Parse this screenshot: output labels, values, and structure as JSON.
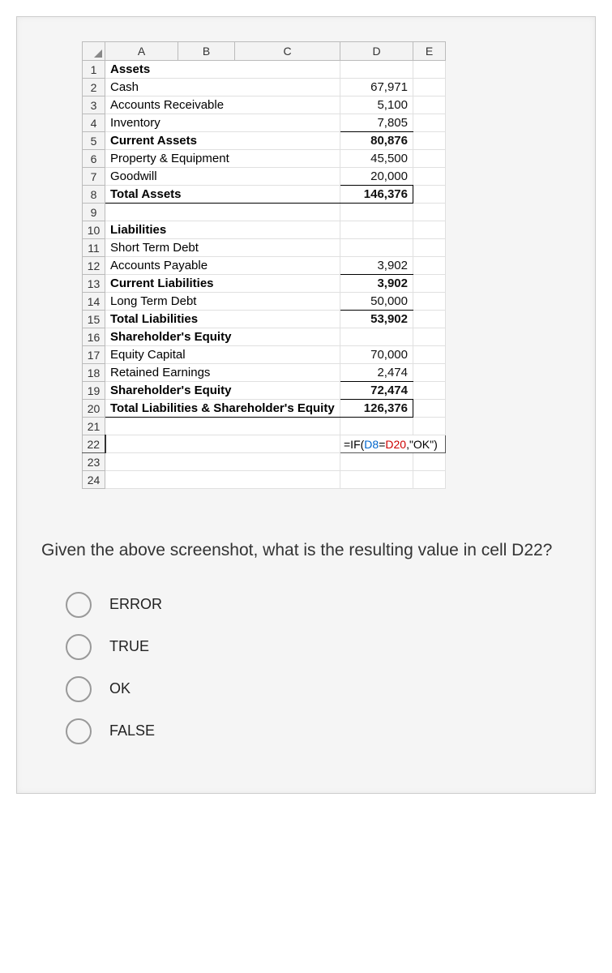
{
  "cols": {
    "corner": "",
    "A": "A",
    "B": "B",
    "C": "C",
    "D": "D",
    "E": "E"
  },
  "rows": {
    "1": {
      "n": "1",
      "a": "Assets",
      "d": "",
      "bold": true
    },
    "2": {
      "n": "2",
      "a": "Cash",
      "d": "67,971",
      "bold": false
    },
    "3": {
      "n": "3",
      "a": "Accounts Receivable",
      "d": "5,100",
      "bold": false
    },
    "4": {
      "n": "4",
      "a": "Inventory",
      "d": "7,805",
      "bold": false,
      "underline": true
    },
    "5": {
      "n": "5",
      "a": "Current Assets",
      "d": "80,876",
      "bold": true
    },
    "6": {
      "n": "6",
      "a": "Property & Equipment",
      "d": "45,500",
      "bold": false
    },
    "7": {
      "n": "7",
      "a": "Goodwill",
      "d": "20,000",
      "bold": false,
      "underline": true
    },
    "8": {
      "n": "8",
      "a": "Total Assets",
      "d": "146,376",
      "bold": true,
      "box": true
    },
    "9": {
      "n": "9",
      "a": "",
      "d": "",
      "bold": false
    },
    "10": {
      "n": "10",
      "a": "Liabilities",
      "d": "",
      "bold": true
    },
    "11": {
      "n": "11",
      "a": "Short Term Debt",
      "d": "",
      "bold": false
    },
    "12": {
      "n": "12",
      "a": "Accounts Payable",
      "d": "3,902",
      "bold": false,
      "underline": true
    },
    "13": {
      "n": "13",
      "a": "Current Liabilities",
      "d": "3,902",
      "bold": true
    },
    "14": {
      "n": "14",
      "a": "Long Term Debt",
      "d": "50,000",
      "bold": false,
      "underline": true
    },
    "15": {
      "n": "15",
      "a": "Total Liabilities",
      "d": "53,902",
      "bold": true
    },
    "16": {
      "n": "16",
      "a": "Shareholder's Equity",
      "d": "",
      "bold": true
    },
    "17": {
      "n": "17",
      "a": "Equity Capital",
      "d": "70,000",
      "bold": false
    },
    "18": {
      "n": "18",
      "a": "Retained Earnings",
      "d": "2,474",
      "bold": false,
      "underline": true
    },
    "19": {
      "n": "19",
      "a": "Shareholder's Equity",
      "d": "72,474",
      "bold": true,
      "underline": true
    },
    "20": {
      "n": "20",
      "a": "Total Liabilities & Shareholder's Equity",
      "d": "126,376",
      "bold": true,
      "box": true
    },
    "21": {
      "n": "21",
      "a": "",
      "d": ""
    },
    "22": {
      "n": "22",
      "a": "",
      "formula": {
        "prefix": "=IF(",
        "ref1": "D8",
        "eq": "=",
        "ref2": "D20",
        "rest": ",\"OK\")"
      }
    },
    "23": {
      "n": "23",
      "a": "",
      "d": ""
    },
    "24": {
      "n": "24",
      "a": "",
      "d": ""
    }
  },
  "question": "Given the above screenshot, what is the resulting value in cell D22?",
  "options": {
    "1": "ERROR",
    "2": "TRUE",
    "3": "OK",
    "4": "FALSE"
  }
}
